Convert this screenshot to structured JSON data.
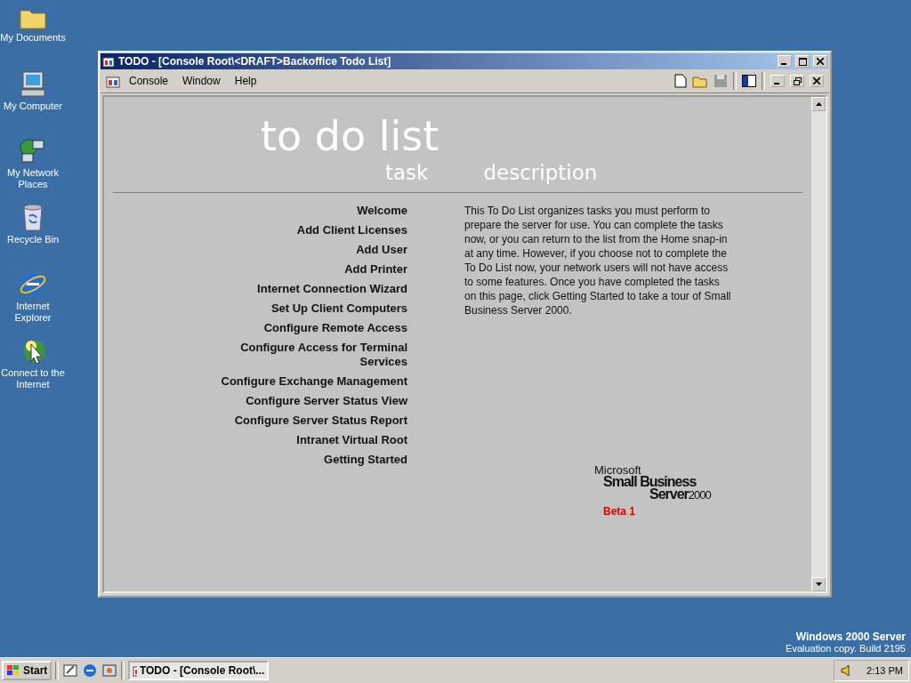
{
  "desktop_icons": [
    {
      "label": "My Documents",
      "kind": "documents"
    },
    {
      "label": "My Computer",
      "kind": "computer"
    },
    {
      "label": "My Network Places",
      "kind": "network"
    },
    {
      "label": "Recycle Bin",
      "kind": "recycle"
    },
    {
      "label": "Internet Explorer",
      "kind": "browser"
    },
    {
      "label": "Connect to the Internet",
      "kind": "connect"
    }
  ],
  "window": {
    "title": "TODO - [Console Root\\<DRAFT>Backoffice Todo List]",
    "menu": [
      "Console",
      "Window",
      "Help"
    ],
    "content": {
      "heading": "to do list",
      "column_headers": [
        "task",
        "description"
      ],
      "tasks": [
        "Welcome",
        "Add Client Licenses",
        "Add User",
        "Add Printer",
        "Internet Connection Wizard",
        "Set Up Client Computers",
        "Configure Remote Access",
        "Configure Access for Terminal Services",
        "Configure Exchange Management",
        "Configure Server Status View",
        "Configure Server Status Report",
        "Intranet Virtual Root",
        "Getting Started"
      ],
      "description": "This To Do List organizes tasks you must perform to prepare the server for use. You can complete the tasks now, or you can return to the list from the Home snap-in at any time. However, if you choose not to complete the To Do List now, your network users will not have access to some features. Once you have completed the tasks on this page, click Getting Started to take a tour of Small Business Server 2000.",
      "logo": {
        "company": "Microsoft",
        "line_1": "Small Business",
        "line_2": "Server",
        "version": "2000",
        "badge": "Beta 1"
      }
    }
  },
  "branding": {
    "title": "Windows 2000 Server",
    "subtitle": "Evaluation copy. Build 2195"
  },
  "taskbar": {
    "start": "Start",
    "tasks": [
      {
        "label": "TODO - [Console Root\\...",
        "selected": true
      }
    ],
    "clock": "2:13 PM"
  }
}
